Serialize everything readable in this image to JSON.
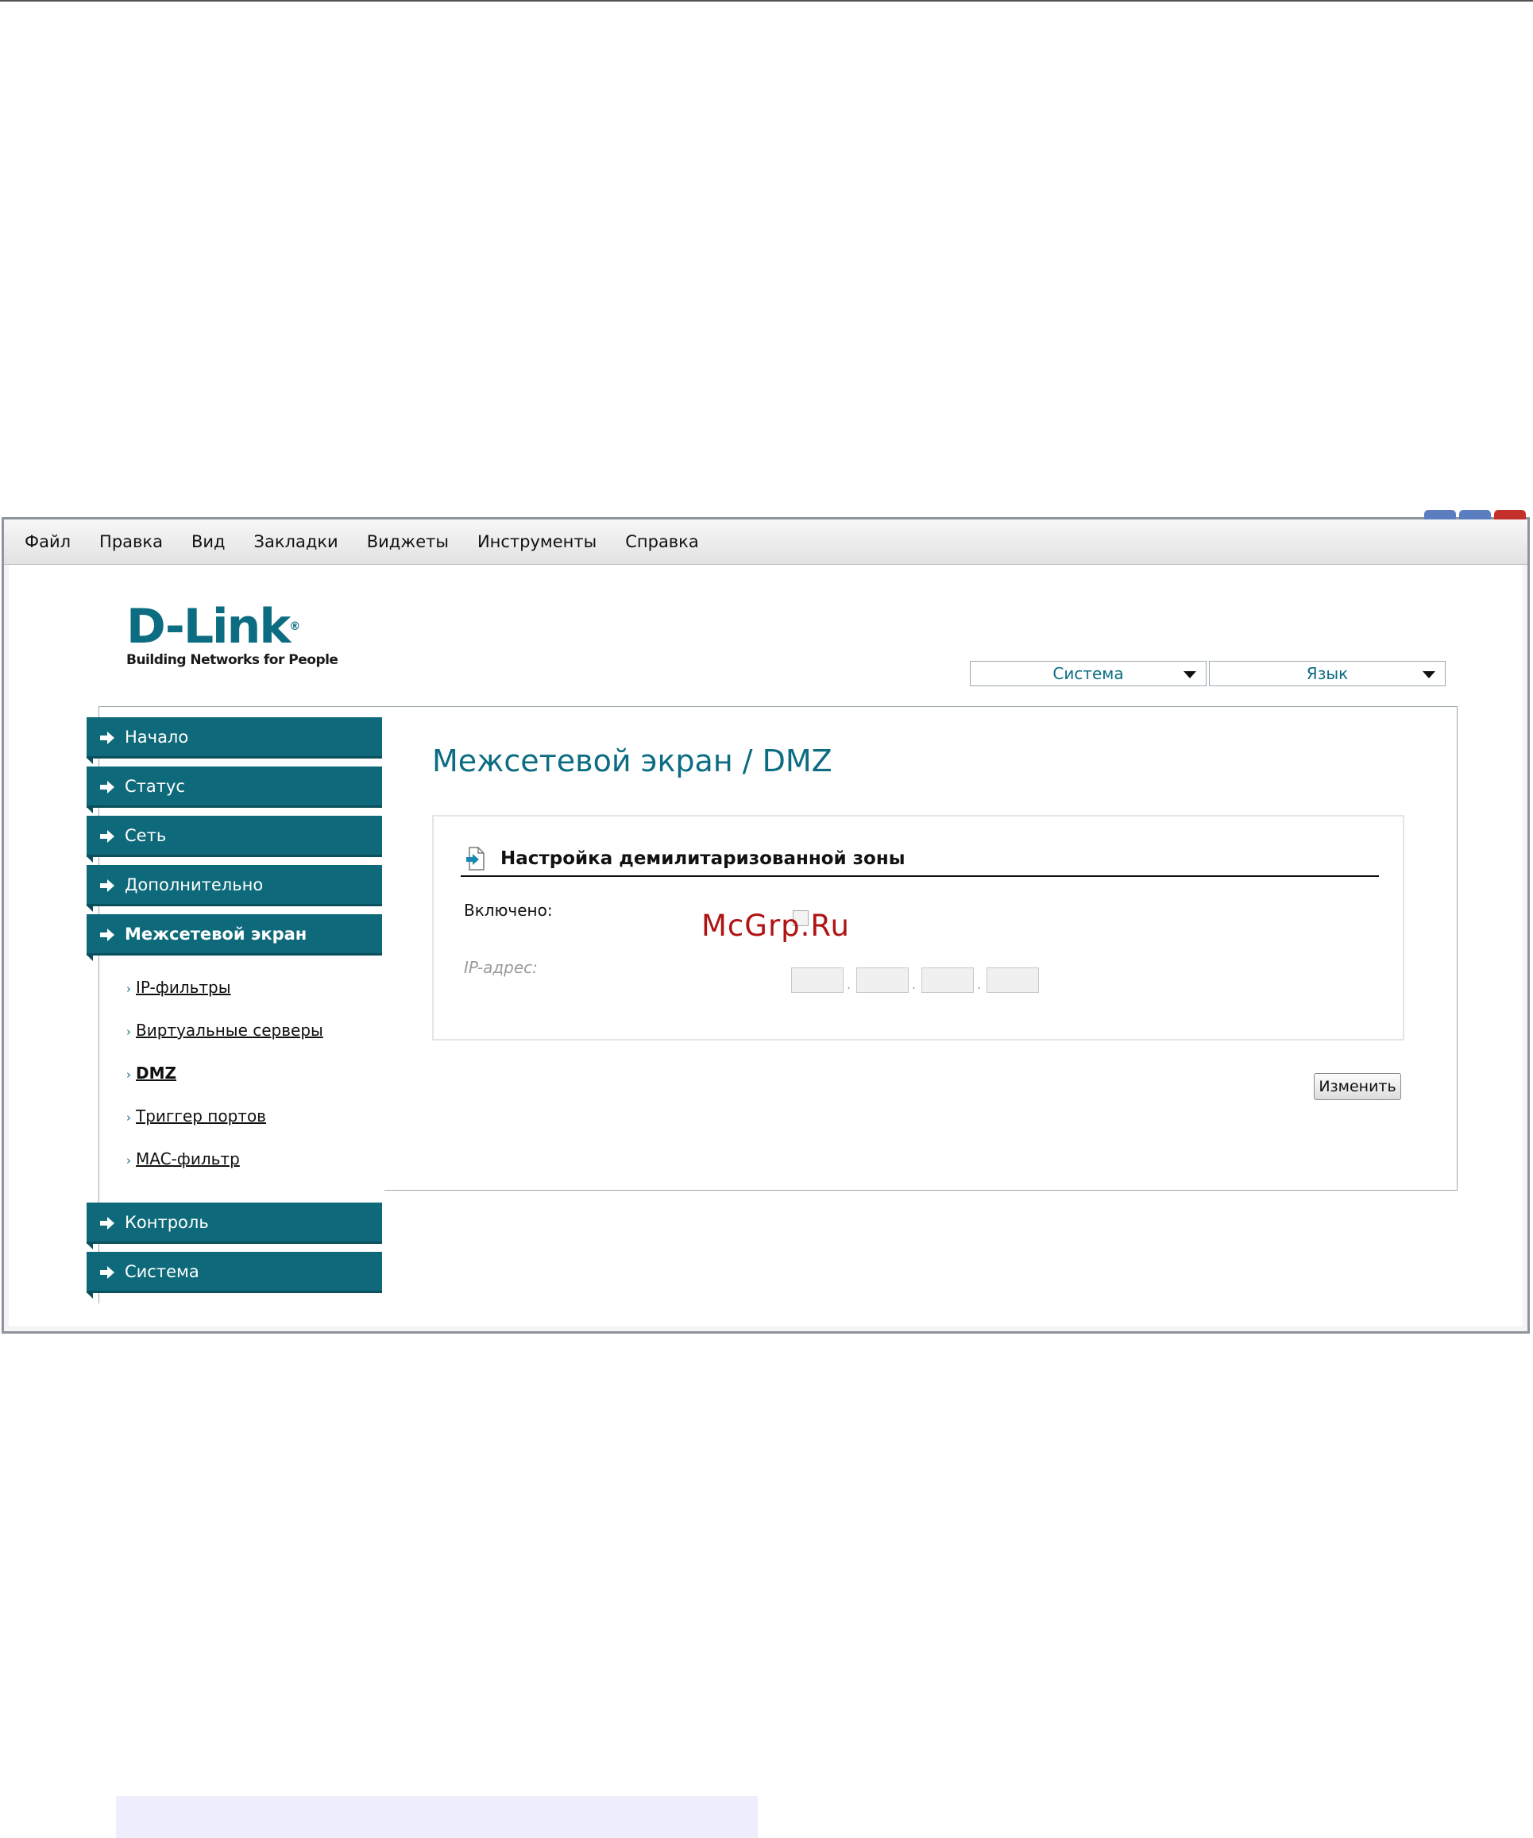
{
  "menubar": [
    "Файл",
    "Правка",
    "Вид",
    "Закладки",
    "Виджеты",
    "Инструменты",
    "Справка"
  ],
  "logo": {
    "brand": "D-Link",
    "registered": "®",
    "tagline": "Building Networks for People"
  },
  "top_selects": {
    "system": "Система",
    "language": "Язык"
  },
  "sidebar": {
    "items": [
      "Начало",
      "Статус",
      "Сеть",
      "Дополнительно",
      "Межсетевой экран",
      "Контроль",
      "Система"
    ],
    "subitems": [
      "IP-фильтры",
      "Виртуальные серверы",
      "DMZ",
      "Триггер портов",
      "MAC-фильтр"
    ],
    "active_item": "Межсетевой экран",
    "current_subitem": "DMZ"
  },
  "main": {
    "title": "Межсетевой экран / DMZ",
    "section_title": "Настройка демилитаризованной зоны",
    "enabled_label": "Включено:",
    "enabled_checked": false,
    "ip_label": "IP-адрес:",
    "ip_octets": [
      "",
      "",
      "",
      ""
    ],
    "change_button": "Изменить"
  },
  "watermark": "McGrp.Ru",
  "colors": {
    "brand": "#0b6c82",
    "nav_bg": "#0e6a7a",
    "watermark": "#b01313"
  },
  "icons": {
    "nav_item": "arrow-right-icon",
    "section": "document-arrow-icon"
  }
}
